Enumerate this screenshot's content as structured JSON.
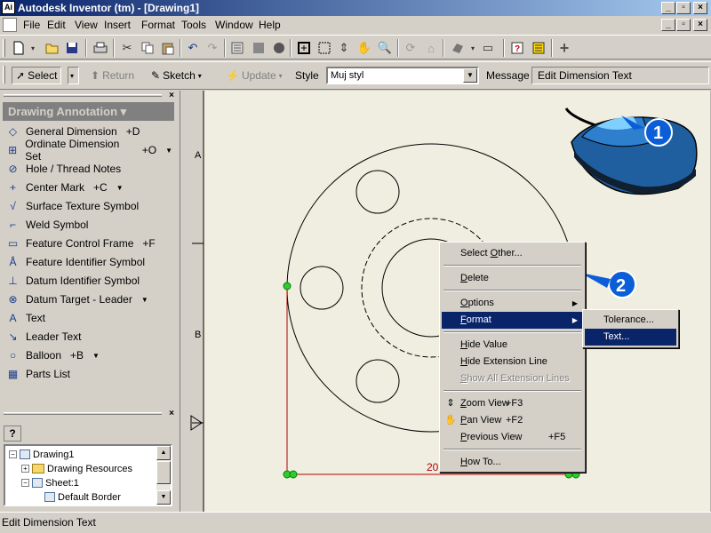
{
  "window": {
    "title": "Autodesk Inventor (tm) - [Drawing1]",
    "app_icon_text": "Ai",
    "controls": [
      "_",
      "▫",
      "×"
    ]
  },
  "menubar": {
    "items": [
      "File",
      "Edit",
      "View",
      "Insert",
      "Format",
      "Tools",
      "Window",
      "Help"
    ],
    "doc_controls": [
      "_",
      "▫",
      "×"
    ]
  },
  "toolbar2": {
    "select_label": "Select",
    "return_label": "Return",
    "sketch_label": "Sketch",
    "update_label": "Update",
    "style_label": "Style",
    "style_value": "Muj styl",
    "message_label": "Message",
    "message_value": "Edit Dimension Text"
  },
  "annotation_panel": {
    "title": "Drawing Annotation ▾",
    "tools": [
      {
        "label": "General Dimension",
        "shortcut": "+D",
        "dropdown": false,
        "icon": "general-dimension-icon"
      },
      {
        "label": "Ordinate Dimension Set",
        "shortcut": "+O",
        "dropdown": true,
        "icon": "ordinate-dimension-icon"
      },
      {
        "label": "Hole / Thread Notes",
        "shortcut": "",
        "dropdown": false,
        "icon": "hole-thread-icon"
      },
      {
        "label": "Center Mark",
        "shortcut": "+C",
        "dropdown": true,
        "icon": "center-mark-icon"
      },
      {
        "label": "Surface Texture Symbol",
        "shortcut": "",
        "dropdown": false,
        "icon": "surface-texture-icon"
      },
      {
        "label": "Weld Symbol",
        "shortcut": "",
        "dropdown": false,
        "icon": "weld-symbol-icon"
      },
      {
        "label": "Feature Control Frame",
        "shortcut": "+F",
        "dropdown": false,
        "icon": "feature-control-frame-icon"
      },
      {
        "label": "Feature Identifier Symbol",
        "shortcut": "",
        "dropdown": false,
        "icon": "feature-identifier-icon"
      },
      {
        "label": "Datum Identifier Symbol",
        "shortcut": "",
        "dropdown": false,
        "icon": "datum-identifier-icon"
      },
      {
        "label": "Datum Target - Leader",
        "shortcut": "",
        "dropdown": true,
        "icon": "datum-target-icon"
      },
      {
        "label": "Text",
        "shortcut": "",
        "dropdown": false,
        "icon": "text-icon"
      },
      {
        "label": "Leader Text",
        "shortcut": "",
        "dropdown": false,
        "icon": "leader-text-icon"
      },
      {
        "label": "Balloon",
        "shortcut": "+B",
        "dropdown": true,
        "icon": "balloon-icon"
      },
      {
        "label": "Parts List",
        "shortcut": "",
        "dropdown": false,
        "icon": "parts-list-icon"
      }
    ]
  },
  "browser": {
    "help_button": "?",
    "tree": [
      {
        "label": "Drawing1",
        "level": 0,
        "expander": "−",
        "icon": "drawing-icon"
      },
      {
        "label": "Drawing Resources",
        "level": 1,
        "expander": "+",
        "icon": "folder-icon"
      },
      {
        "label": "Sheet:1",
        "level": 1,
        "expander": "−",
        "icon": "sheet-icon"
      },
      {
        "label": "Default Border",
        "level": 2,
        "expander": "",
        "icon": "border-icon"
      }
    ]
  },
  "drawing": {
    "zone_labels": [
      "A",
      "B"
    ],
    "dimension_text": "20",
    "callout_1": "1",
    "callout_2": "2"
  },
  "context_menu": {
    "items": [
      {
        "label": "Select Other...",
        "underline": "O",
        "shortcut": "",
        "submenu": false,
        "disabled": false,
        "highlight": false,
        "sep_after": true
      },
      {
        "label": "Delete",
        "underline": "D",
        "shortcut": "",
        "submenu": false,
        "disabled": false,
        "highlight": false,
        "sep_after": true
      },
      {
        "label": "Options",
        "underline": "O",
        "shortcut": "",
        "submenu": true,
        "disabled": false,
        "highlight": false,
        "sep_after": false
      },
      {
        "label": "Format",
        "underline": "F",
        "shortcut": "",
        "submenu": true,
        "disabled": false,
        "highlight": true,
        "sep_after": true
      },
      {
        "label": "Hide Value",
        "underline": "H",
        "shortcut": "",
        "submenu": false,
        "disabled": false,
        "highlight": false,
        "sep_after": false
      },
      {
        "label": "Hide Extension Line",
        "underline": "H",
        "shortcut": "",
        "submenu": false,
        "disabled": false,
        "highlight": false,
        "sep_after": false
      },
      {
        "label": "Show All Extension Lines",
        "underline": "S",
        "shortcut": "",
        "submenu": false,
        "disabled": true,
        "highlight": false,
        "sep_after": true
      },
      {
        "label": "Zoom View",
        "underline": "Z",
        "shortcut": "+F3",
        "submenu": false,
        "disabled": false,
        "highlight": false,
        "sep_after": false,
        "icon": "zoom-icon"
      },
      {
        "label": "Pan View",
        "underline": "P",
        "shortcut": "+F2",
        "submenu": false,
        "disabled": false,
        "highlight": false,
        "sep_after": false,
        "icon": "pan-icon"
      },
      {
        "label": "Previous View",
        "underline": "P",
        "shortcut": "+F5",
        "submenu": false,
        "disabled": false,
        "highlight": false,
        "sep_after": true
      },
      {
        "label": "How To...",
        "underline": "H",
        "shortcut": "",
        "submenu": false,
        "disabled": false,
        "highlight": false,
        "sep_after": false
      }
    ]
  },
  "submenu": {
    "items": [
      {
        "label": "Tolerance...",
        "highlight": false
      },
      {
        "label": "Text...",
        "highlight": true
      }
    ]
  },
  "statusbar": {
    "text": "Edit Dimension Text"
  },
  "colors": {
    "title_start": "#0a246a",
    "title_end": "#a6caf0",
    "highlight": "#0a246a",
    "paper": "#f0eee0",
    "dimension": "#b00000",
    "callout": "#0b5ed7"
  }
}
